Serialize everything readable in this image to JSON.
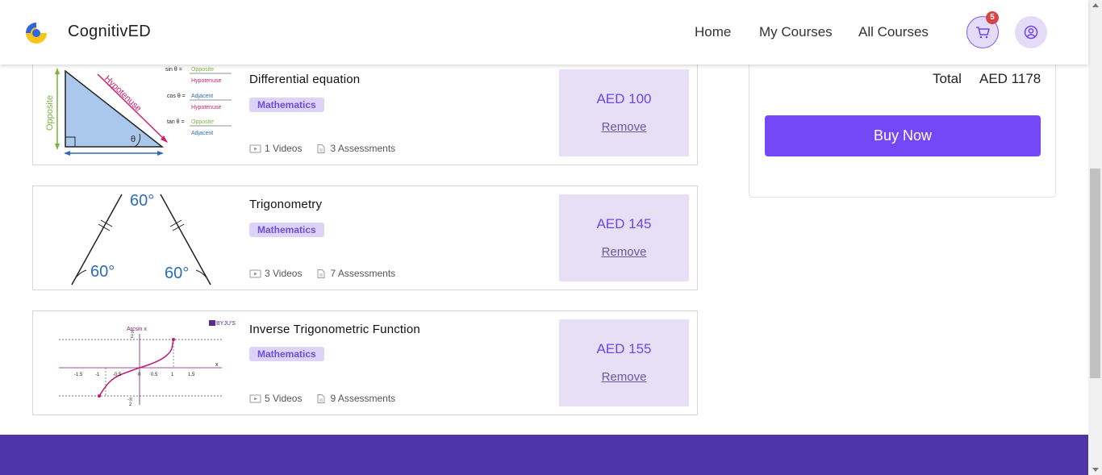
{
  "header": {
    "brand": "CognitivED",
    "nav": [
      "Home",
      "My Courses",
      "All Courses"
    ],
    "cart_count": "5"
  },
  "courses": [
    {
      "title": "Differential equation",
      "tag": "Mathematics",
      "videos": "1 Videos",
      "assessments": "3 Assessments",
      "price": "AED 100",
      "remove": "Remove",
      "thumb": {
        "opposite": "Opposite",
        "hypotenuse": "Hypotenuse",
        "theta": "θ",
        "sin": "sin θ =",
        "cos": "cos θ =",
        "tan": "tan θ =",
        "f_opposite": "Opposite",
        "f_hypotenuse": "Hypotenuse",
        "f_adjacent": "Adjacent"
      }
    },
    {
      "title": "Trigonometry",
      "tag": "Mathematics",
      "videos": "3 Videos",
      "assessments": "7 Assessments",
      "price": "AED 145",
      "remove": "Remove",
      "thumb": {
        "top": "60°",
        "left": "60°",
        "right": "60°"
      }
    },
    {
      "title": "Inverse Trigonometric Function",
      "tag": "Mathematics",
      "videos": "5 Videos",
      "assessments": "9 Assessments",
      "price": "AED 155",
      "remove": "Remove",
      "thumb": {
        "title": "Arcsin x",
        "xaxis": "x",
        "ticks": [
          "-1.5",
          "-1",
          "-0.5",
          "0",
          "0.5",
          "1",
          "1.5"
        ],
        "watermark": "BYJU'S"
      }
    }
  ],
  "summary": {
    "total_label": "Total",
    "total_value": "AED 1178",
    "buy_label": "Buy Now"
  },
  "colors": {
    "accent": "#7548f7",
    "footer": "#4e35a8",
    "price_bg": "#e6dff5"
  }
}
